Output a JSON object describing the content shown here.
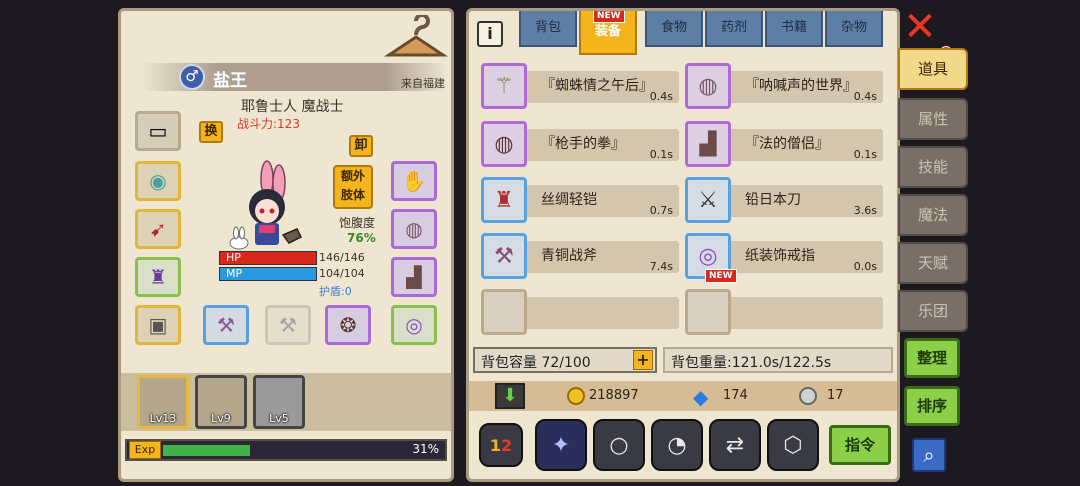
{
  "character": {
    "name": "盐王",
    "gender_symbol": "♂",
    "origin": "来自福建",
    "race_class": "耶鲁士人 魔战士",
    "power": "战斗力:123",
    "swap_label": "换",
    "unequip_label": "卸",
    "extra_limb_label_1": "额外",
    "extra_limb_label_2": "肢体",
    "hunger_label": "饱腹度",
    "hunger_value": "76%",
    "hp_label": "HP",
    "hp_value": "146/146",
    "hp_fraction": 1.0,
    "mp_label": "MP",
    "mp_value": "104/104",
    "mp_fraction": 1.0,
    "shield_label": "护盾:0"
  },
  "party": [
    {
      "level": "Lv13"
    },
    {
      "level": "Lv9"
    },
    {
      "level": "Lv5"
    }
  ],
  "exp": {
    "label": "Exp",
    "percent_text": "31%",
    "fraction": 0.31
  },
  "inventory": {
    "info_icon": "i",
    "tabs": [
      {
        "label": "背包"
      },
      {
        "label": "装备",
        "badge": "NEW"
      },
      {
        "label": "食物"
      },
      {
        "label": "药剂"
      },
      {
        "label": "书籍"
      },
      {
        "label": "杂物"
      }
    ],
    "items": [
      {
        "name": "『蜘蛛情之午后』",
        "weight": "0.4s",
        "icon": "staff-icon"
      },
      {
        "name": "『呐喊声的世界』",
        "weight": "0.4s",
        "icon": "belt-icon"
      },
      {
        "name": "『枪手的拳』",
        "weight": "0.1s",
        "icon": "belt-icon"
      },
      {
        "name": "『法的僧侣』",
        "weight": "0.1s",
        "icon": "boots-icon"
      },
      {
        "name": "丝绸轻铠",
        "weight": "0.7s",
        "icon": "armor-icon"
      },
      {
        "name": "铅日本刀",
        "weight": "3.6s",
        "icon": "katana-icon"
      },
      {
        "name": "青铜战斧",
        "weight": "7.4s",
        "icon": "axe-icon"
      },
      {
        "name": "纸装饰戒指",
        "weight": "0.0s",
        "icon": "ring-icon",
        "badge": "NEW"
      }
    ],
    "capacity": "背包容量 72/100",
    "weight": "背包重量:121.0s/122.5s",
    "gold": "218897",
    "gems": "174",
    "silver": "17",
    "command_label": "指令"
  },
  "side": {
    "tabs": [
      {
        "label": "道具"
      },
      {
        "label": "属性"
      },
      {
        "label": "技能"
      },
      {
        "label": "魔法"
      },
      {
        "label": "天赋"
      },
      {
        "label": "乐团"
      }
    ],
    "sort_label": "整理",
    "order_label": "排序"
  },
  "colors": {
    "accent": "#f4b41c",
    "panel": "#efe6d2",
    "hp": "#d8281c",
    "mp": "#2a9ae0",
    "exp": "#3fb24a"
  }
}
